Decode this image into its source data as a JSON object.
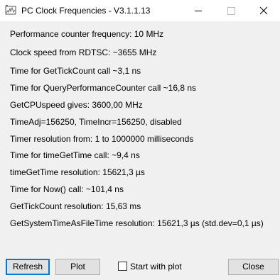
{
  "window": {
    "title": "PC Clock Frequencies - V3.1.1.13",
    "controls": {
      "minimize_icon": "minimize-icon",
      "maximize_icon": "maximize-icon",
      "close_icon": "close-icon"
    }
  },
  "info": [
    "Performance counter frequency: 10 MHz",
    "Clock speed from RDTSC: ~3655 MHz",
    "Time for GetTickCount call ~3,1 ns",
    "Time for QueryPerformanceCounter call ~16,8 ns",
    "GetCPUspeed gives: 3600,00 MHz",
    "TimeAdj=156250, TimeIncr=156250, disabled",
    "Timer resolution from: 1 to 1000000 milliseconds",
    "Time for timeGetTime call: ~9,4 ns",
    "timeGetTime resolution: 15621,3 µs",
    "Time for Now() call: ~101,4 ns",
    "GetTickCount resolution: 15,63 ms",
    "GetSystemTimeAsFileTime resolution: 15621,3 µs  (std.dev=0,1 µs)"
  ],
  "buttons": {
    "refresh": "Refresh",
    "plot": "Plot",
    "close": "Close"
  },
  "start_with_plot": {
    "label": "Start with plot",
    "checked": false
  },
  "colors": {
    "window_bg": "#f0f0f0",
    "titlebar_bg": "#ffffff",
    "button_bg": "#e1e1e1",
    "button_border": "#adadad",
    "focus_border": "#0078d7"
  }
}
